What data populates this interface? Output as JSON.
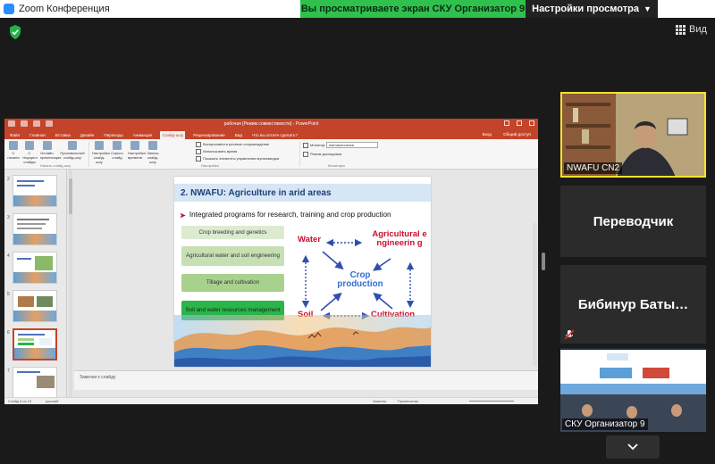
{
  "window": {
    "title": "Zoom Конференция"
  },
  "banner": {
    "sharing_text": "Вы просматриваете экран СКУ Организатор 9"
  },
  "view_options": {
    "label": "Настройки просмотра"
  },
  "top_right": {
    "view_label": "Вид"
  },
  "ppt": {
    "title": "рабочая [Режим совместимости] - PowerPoint",
    "tabs": [
      "Файл",
      "Главная",
      "Вставка",
      "Дизайн",
      "Переходы",
      "Анимация",
      "Слайд-шоу",
      "Рецензирование",
      "Вид",
      "Что вы хотите сделать?"
    ],
    "active_tab_index": 6,
    "ribbon": {
      "buttons": [
        "С начала",
        "С текущего слайда",
        "Онлайн-презентация",
        "Произвольный слайд-шоу",
        "Настройка слайд-шоу",
        "Скрыть слайд",
        "Настройка времени",
        "Запись слайд-шоу"
      ],
      "checkboxes": [
        "Воспроизвести речевое сопровождение",
        "Использовать время",
        "Показать элементы управления мультимедиа"
      ],
      "monitor_label": "Монитор:",
      "monitor_value": "Автоматически",
      "presenter_label": "Режим докладчика",
      "groups": [
        "Начать слайд-шоу",
        "Настройка",
        "Мониторы"
      ],
      "sign_in": "Вход",
      "share": "Общий доступ"
    },
    "thumbnails": [
      "2",
      "3",
      "4",
      "5",
      "6",
      "7"
    ],
    "notes_placeholder": "Заметки к слайду",
    "status": {
      "slide": "Слайд 6 из 15",
      "lang": "русский",
      "notes": "Заметки",
      "comments": "Примечания"
    }
  },
  "slide": {
    "title": "2. NWAFU: Agriculture in arid areas",
    "subtitle": "Integrated programs for research, training and crop production",
    "boxes": [
      "Crop breeding and genetics",
      "Agricultural water and soil engineering",
      "Tillage and cultivation",
      "Soil and water resources management"
    ],
    "diagram": {
      "water": "Water",
      "engineering": "Agricultural engineerin g",
      "center": "Crop production",
      "soil": "Soil",
      "cultivation": "Cultivation"
    }
  },
  "participants": [
    {
      "name": "NWAFU CN2"
    },
    {
      "name": "Переводчик"
    },
    {
      "name": "Бибинур  Баты…"
    },
    {
      "name": "СКУ Организатор 9"
    }
  ],
  "colors": {
    "share_green": "#2fc04d",
    "active_speaker": "#f6e22c",
    "ppt_red": "#c4442a"
  }
}
